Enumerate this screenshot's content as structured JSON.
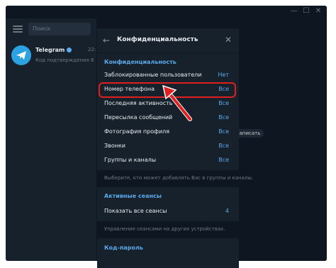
{
  "sidebar": {
    "search_placeholder": "Поиск",
    "chat": {
      "name": "Telegram",
      "time": "22:5",
      "preview": "Код подтверждения 69..."
    }
  },
  "main": {
    "hint": "написать"
  },
  "privacy": {
    "title": "Конфиденциальность",
    "section_privacy": "Конфиденциальность",
    "rows": [
      {
        "label": "Заблокированные пользователи",
        "value": "Нет"
      },
      {
        "label": "Номер телефона",
        "value": "Все"
      },
      {
        "label": "Последняя активность",
        "value": "Все"
      },
      {
        "label": "Пересылка сообщений",
        "value": "Все"
      },
      {
        "label": "Фотография профиля",
        "value": "Все"
      },
      {
        "label": "Звонки",
        "value": "Все"
      },
      {
        "label": "Группы и каналы",
        "value": "Все"
      }
    ],
    "groups_hint": "Выберите, кто может добавлять Вас в группы и каналы.",
    "section_sessions": "Активные сеансы",
    "sessions_row": {
      "label": "Показать все сеансы",
      "value": "4"
    },
    "sessions_hint": "Управление сеансами на других устройствах.",
    "section_passcode": "Код-пароль"
  },
  "colors": {
    "accent": "#5aaaed",
    "highlight": "#e02020",
    "panel_bg": "#17212b"
  }
}
